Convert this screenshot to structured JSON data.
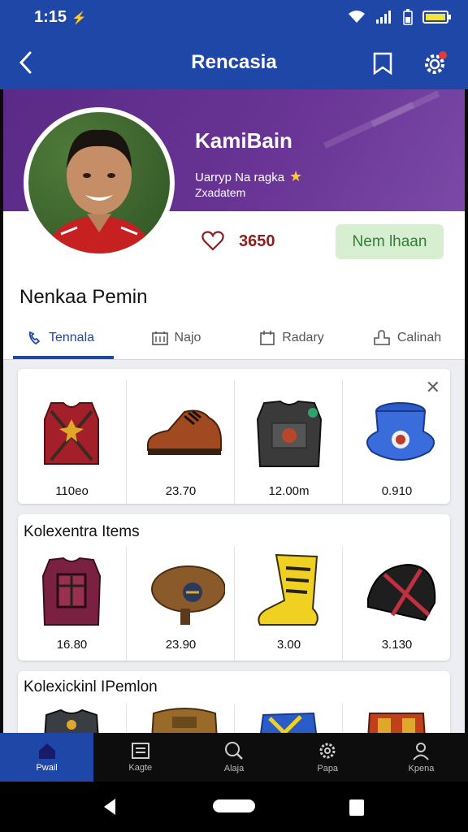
{
  "status_bar": {
    "time": "1:15"
  },
  "app_bar": {
    "title": "Rencasia",
    "icons": [
      "back-arrow-icon",
      "bookmark-icon",
      "gear-icon"
    ]
  },
  "profile": {
    "name": "KamiBain",
    "subtitle1": "Uarryp Na ragka",
    "subtitle2": "Zxadatem",
    "likes_count": "3650",
    "follow_label": "Nem lhaan"
  },
  "section_title": "Nenkaa Pemin",
  "tabs": [
    {
      "label": "Tennala",
      "icon": "phone-icon"
    },
    {
      "label": "Najo",
      "icon": "calendar-grid-icon"
    },
    {
      "label": "Radary",
      "icon": "calendar-icon"
    },
    {
      "label": "Calinah",
      "icon": "puzzle-icon"
    }
  ],
  "cards": [
    {
      "title": "",
      "items": [
        {
          "name": "red-vest",
          "price": "110eo"
        },
        {
          "name": "brown-shoe",
          "price": "23.70"
        },
        {
          "name": "armor-vest",
          "price": "12.00m"
        },
        {
          "name": "blue-pot",
          "price": "0.910"
        }
      ]
    },
    {
      "title": "Kolexentra Items",
      "items": [
        {
          "name": "maroon-vest",
          "price": "16.80"
        },
        {
          "name": "brown-hat",
          "price": "23.90"
        },
        {
          "name": "yellow-boot",
          "price": "3.00"
        },
        {
          "name": "black-helmet",
          "price": "3.130"
        }
      ]
    },
    {
      "title": "Kolexickinl IPemlon",
      "items": [
        {
          "name": "gray-vest"
        },
        {
          "name": "tan-backpack"
        },
        {
          "name": "blue-armor"
        },
        {
          "name": "red-backpack"
        }
      ]
    }
  ],
  "bottom_nav": [
    {
      "label": "Pwail",
      "icon": "home-icon",
      "active": true
    },
    {
      "label": "Kagte",
      "icon": "store-icon",
      "active": false
    },
    {
      "label": "Alaja",
      "icon": "search-icon",
      "active": false
    },
    {
      "label": "Papa",
      "icon": "settings-icon",
      "active": false
    },
    {
      "label": "Kpena",
      "icon": "user-icon",
      "active": false
    }
  ],
  "colors": {
    "primary": "#1f47a8",
    "header_purple": "#5a2a86",
    "follow_bg": "#d7efd0",
    "follow_text": "#2f7f3a"
  }
}
